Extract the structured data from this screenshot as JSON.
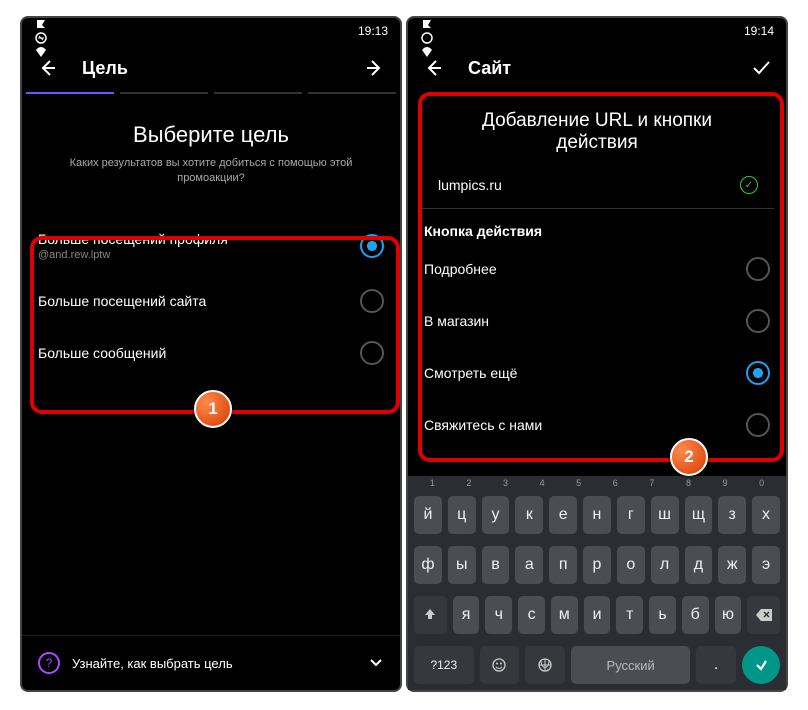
{
  "left": {
    "status_time": "19:13",
    "header": "Цель",
    "h1": "Выберите цель",
    "sub": "Каких результатов вы хотите добиться с помощью этой промоакции?",
    "options": [
      {
        "label": "Больше посещений профиля",
        "meta": "@and.rew.lptw",
        "selected": true
      },
      {
        "label": "Больше посещений сайта",
        "meta": "",
        "selected": false
      },
      {
        "label": "Больше сообщений",
        "meta": "",
        "selected": false
      }
    ],
    "hint": "Узнайте, как выбрать цель"
  },
  "right": {
    "status_time": "19:14",
    "header": "Сайт",
    "h1": "Добавление URL и кнопки действия",
    "url_value": "lumpics.ru",
    "sec_title": "Кнопка действия",
    "options": [
      {
        "label": "Подробнее",
        "selected": false
      },
      {
        "label": "В магазин",
        "selected": false
      },
      {
        "label": "Смотреть ещё",
        "selected": true
      },
      {
        "label": "Свяжитесь с нами",
        "selected": false
      }
    ],
    "kbd": {
      "nums": [
        "1",
        "2",
        "3",
        "4",
        "5",
        "6",
        "7",
        "8",
        "9",
        "0"
      ],
      "r1": [
        "й",
        "ц",
        "у",
        "к",
        "е",
        "н",
        "г",
        "ш",
        "щ",
        "з",
        "х"
      ],
      "r2": [
        "ф",
        "ы",
        "в",
        "а",
        "п",
        "р",
        "о",
        "л",
        "д",
        "ж",
        "э"
      ],
      "r3": [
        "я",
        "ч",
        "с",
        "м",
        "и",
        "т",
        "ь",
        "б",
        "ю"
      ],
      "sym": "?123",
      "lang": "Русский"
    }
  },
  "badges": {
    "b1": "1",
    "b2": "2"
  }
}
